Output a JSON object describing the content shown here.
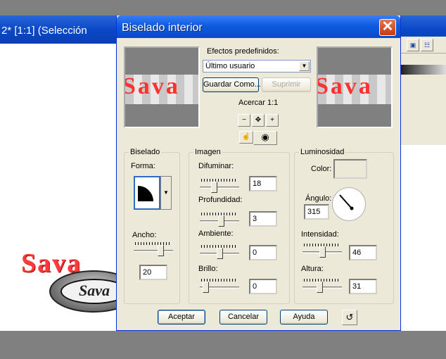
{
  "background_window": {
    "title": "2* [1:1] (Selección",
    "toolbar_icons": [
      "save-icon",
      "link-icon"
    ],
    "logo_text": "Sava",
    "logo_badge_text": "Sava"
  },
  "dialog": {
    "title": "Biselado interior",
    "presets": {
      "label": "Efectos predefinidos:",
      "selected": "Último usuario",
      "save_label": "Guardar Como...",
      "delete_label": "Suprimir"
    },
    "preview": {
      "text": "Sava",
      "zoom_label": "Acercar 1:1",
      "zoom_out_icon": "zoom-out-icon",
      "pan_icon": "pan-icon",
      "zoom_in_icon": "zoom-in-icon",
      "hand_icon": "hand-icon",
      "eye_icon": "eye-icon"
    },
    "bevel": {
      "title": "Biselado",
      "shape_label": "Forma:",
      "width_label": "Ancho:",
      "width_value": "20"
    },
    "image": {
      "title": "Imagen",
      "blur_label": "Difuminar:",
      "blur_value": "18",
      "depth_label": "Profundidad:",
      "depth_value": "3",
      "ambient_label": "Ambiente:",
      "ambient_value": "0",
      "brightness_label": "Brillo:",
      "brightness_value": "0"
    },
    "light": {
      "title": "Luminosidad",
      "color_label": "Color:",
      "angle_label": "Ángulo:",
      "angle_value": "315",
      "intensity_label": "Intensidad:",
      "intensity_value": "46",
      "height_label": "Altura:",
      "height_value": "31"
    },
    "buttons": {
      "ok": "Aceptar",
      "cancel": "Cancelar",
      "help": "Ayuda",
      "reset_icon": "reset-icon"
    }
  },
  "colors": {
    "title_bar": "#0a4ac8",
    "dialog_bg": "#ece9d8",
    "accent_red": "#ff3131",
    "close_button": "#c33a12"
  }
}
